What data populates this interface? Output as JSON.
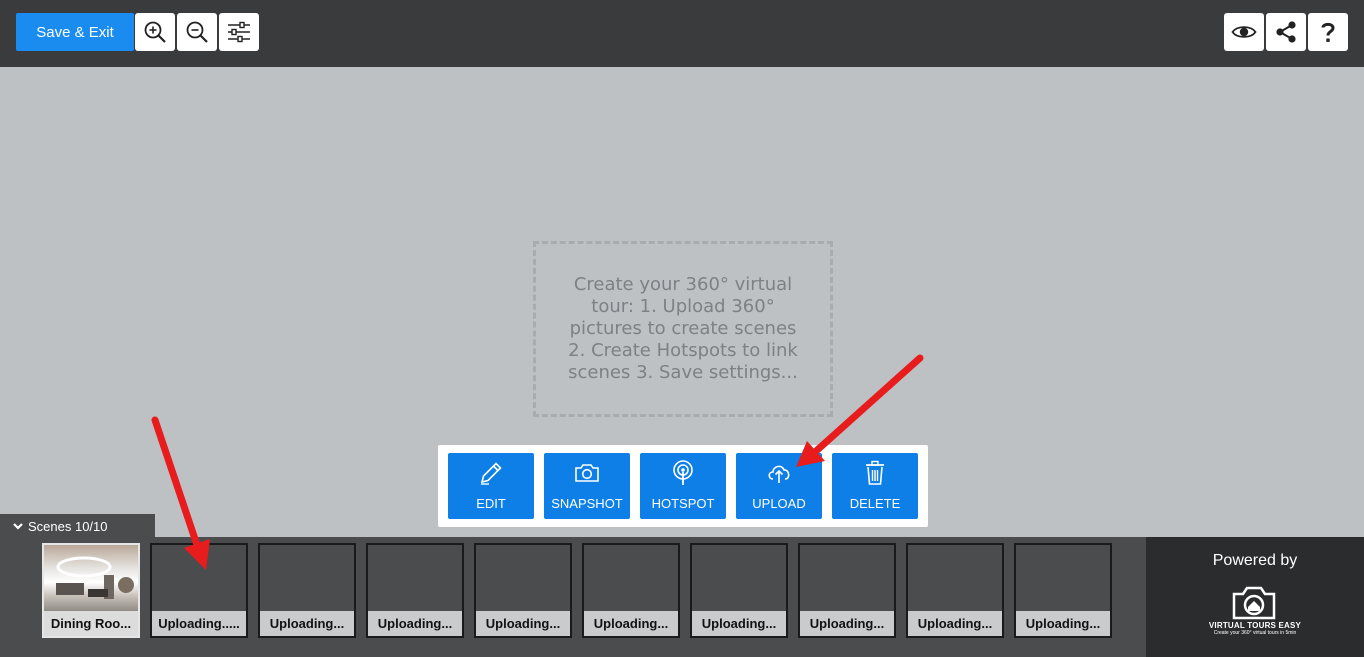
{
  "toolbar": {
    "save_exit_label": "Save & Exit",
    "left_tools": [
      "zoom-in-icon",
      "zoom-out-icon",
      "settings-sliders-icon"
    ],
    "right_tools": [
      "eye-icon",
      "share-icon",
      "help-icon"
    ]
  },
  "canvas": {
    "instruction": "Create your 360° virtual tour: 1. Upload 360° pictures to create scenes 2. Create Hotspots to link scenes 3. Save settings..."
  },
  "actions": [
    {
      "label": "EDIT",
      "icon": "pencil-icon"
    },
    {
      "label": "SNAPSHOT",
      "icon": "camera-icon"
    },
    {
      "label": "HOTSPOT",
      "icon": "hotspot-icon"
    },
    {
      "label": "UPLOAD",
      "icon": "cloud-upload-icon"
    },
    {
      "label": "DELETE",
      "icon": "trash-icon"
    }
  ],
  "scenes": {
    "tab_label": "Scenes 10/10",
    "items": [
      {
        "caption": "Dining Roo..."
      },
      {
        "caption": "Uploading....."
      },
      {
        "caption": "Uploading..."
      },
      {
        "caption": "Uploading..."
      },
      {
        "caption": "Uploading..."
      },
      {
        "caption": "Uploading..."
      },
      {
        "caption": "Uploading..."
      },
      {
        "caption": "Uploading..."
      },
      {
        "caption": "Uploading..."
      },
      {
        "caption": "Uploading..."
      }
    ]
  },
  "powered": {
    "label": "Powered by",
    "brand": "VIRTUAL TOURS EASY",
    "tagline": "Create your 360° virtual tours in 5min"
  },
  "colors": {
    "accent": "#0e7fe6",
    "topbar": "#3a3b3d",
    "canvas": "#bdc1c4",
    "annotation_arrow": "#e81c1c"
  }
}
